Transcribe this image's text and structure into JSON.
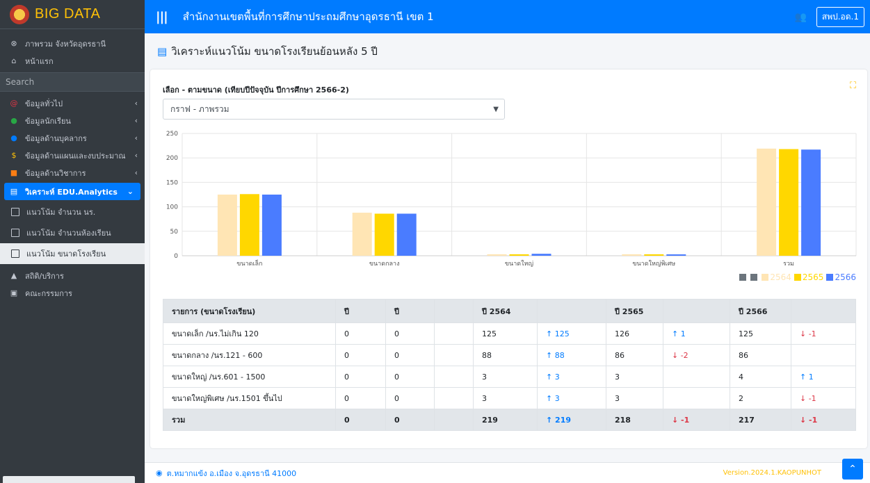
{
  "brand": {
    "name": "BIG DATA"
  },
  "header": {
    "title": "สำนักงานเขตพื้นที่การศึกษาประถมศึกษาอุดรธานี เขต 1",
    "user": "สพป.อด.1"
  },
  "sidebar": {
    "top_items": [
      {
        "label": "ภาพรวม จังหวัดอุดรธานี",
        "icon": "globe-icon"
      },
      {
        "label": "หน้าแรก",
        "icon": "home-icon"
      }
    ],
    "search_placeholder": "Search",
    "menu": [
      {
        "label": "ข้อมูลทั่วไป",
        "icon": "at-icon",
        "color": "#dc3545"
      },
      {
        "label": "ข้อมูลนักเรียน",
        "icon": "student-icon",
        "color": "#28a745"
      },
      {
        "label": "ข้อมูลด้านบุคลากร",
        "icon": "user-icon",
        "color": "#007bff"
      },
      {
        "label": "ข้อมูลด้านแผนและงบประมาณ",
        "icon": "money-icon",
        "color": "#ffc107"
      },
      {
        "label": "ข้อมูลด้านวิชาการ",
        "icon": "academic-icon",
        "color": "#fd7e14"
      }
    ],
    "active": {
      "label": "วิเคราะห์ EDU.Analytics"
    },
    "sub_items": [
      "แนวโน้ม จำนวน นร.",
      "แนวโน้ม จำนวนห้องเรียน",
      "แนวโน้ม ขนาดโรงเรียน"
    ],
    "bottom_items": [
      {
        "label": "สถิติ/บริการ",
        "icon": "thumbs-up-icon"
      },
      {
        "label": "คณะกรรมการ",
        "icon": "id-card-icon"
      }
    ]
  },
  "page": {
    "title": "วิเคราะห์แนวโน้ม ขนาดโรงเรียนย้อนหลัง 5 ปี",
    "card_label": "เลือก - ตามขนาด (เทียบปีปัจจุบัน ปีการศึกษา 2566-2)",
    "select_value": "กราฟ - ภาพรวม"
  },
  "chart_data": {
    "type": "bar",
    "categories": [
      "ขนาดเล็ก",
      "ขนาดกลาง",
      "ขนาดใหญ่",
      "ขนาดใหญ่พิเศษ",
      "รวม"
    ],
    "series": [
      {
        "name": "",
        "values": [
          0,
          0,
          0,
          0,
          0
        ],
        "color": "#6c757d"
      },
      {
        "name": "",
        "values": [
          0,
          0,
          0,
          0,
          0
        ],
        "color": "#6c757d"
      },
      {
        "name": "2564",
        "values": [
          125,
          88,
          3,
          3,
          219
        ],
        "color": "#ffe5b4"
      },
      {
        "name": "2565",
        "values": [
          126,
          86,
          3,
          3,
          218
        ],
        "color": "#ffd700"
      },
      {
        "name": "2566",
        "values": [
          125,
          86,
          4,
          2,
          217
        ],
        "color": "#4a7cff"
      }
    ],
    "ylim": [
      0,
      250
    ],
    "yticks": [
      0,
      50,
      100,
      150,
      200,
      250
    ],
    "legend_position": "bottom-right",
    "grid": true
  },
  "table": {
    "headers": [
      "รายการ (ขนาดโรงเรียน)",
      "ปี",
      "ปี",
      "",
      "ปี 2564",
      "",
      "ปี 2565",
      "",
      "ปี 2566",
      ""
    ],
    "rows": [
      [
        "ขนาดเล็ก /นร.ไม่เกิน 120",
        "0",
        "0",
        "",
        "125",
        "↑ 125",
        "126",
        "↑ 1",
        "125",
        "↓ -1"
      ],
      [
        "ขนาดกลาง /นร.121 - 600",
        "0",
        "0",
        "",
        "88",
        "↑ 88",
        "86",
        "↓ -2",
        "86",
        ""
      ],
      [
        "ขนาดใหญ่ /นร.601 - 1500",
        "0",
        "0",
        "",
        "3",
        "↑ 3",
        "3",
        "",
        "4",
        "↑ 1"
      ],
      [
        "ขนาดใหญ่พิเศษ /นร.1501 ขึ้นไป",
        "0",
        "0",
        "",
        "3",
        "↑ 3",
        "3",
        "",
        "2",
        "↓ -1"
      ]
    ],
    "total": [
      "รวม",
      "0",
      "0",
      "",
      "219",
      "↑ 219",
      "218",
      "↓ -1",
      "217",
      "↓ -1"
    ]
  },
  "footer": {
    "address": "ต.หมากแข้ง อ.เมือง จ.อุดรธานี 41000",
    "version": "Version.2024.1.KAOPUNHOT"
  }
}
